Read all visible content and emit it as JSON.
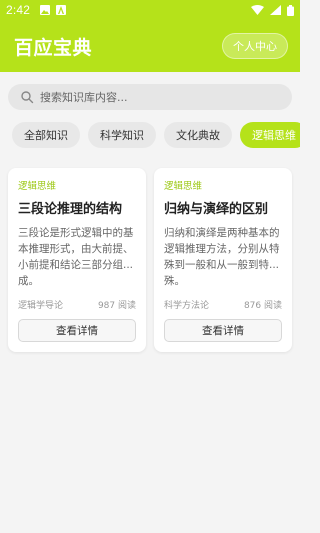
{
  "status_bar": {
    "time": "2:42",
    "icons": [
      "image-icon",
      "font-icon",
      "wifi-icon",
      "cellular-icon",
      "battery-icon"
    ]
  },
  "app": {
    "title": "百应宝典",
    "profile_button": "个人中心"
  },
  "search": {
    "placeholder": "搜索知识库内容..."
  },
  "categories": [
    {
      "label": "全部知识",
      "active": false
    },
    {
      "label": "科学知识",
      "active": false
    },
    {
      "label": "文化典故",
      "active": false
    },
    {
      "label": "逻辑思维",
      "active": true
    }
  ],
  "cards": [
    {
      "category": "逻辑思维",
      "title": "三段论推理的结构",
      "summary": "三段论是形式逻辑中的基本推理形式，由大前提、小前提和结论三部分组...成。",
      "source": "逻辑学导论",
      "reads": "987 阅读",
      "button": "查看详情"
    },
    {
      "category": "逻辑思维",
      "title": "归纳与演绎的区别",
      "summary": "归纳和演绎是两种基本的逻辑推理方法，分别从特殊到一般和从一般到特...殊。",
      "source": "科学方法论",
      "reads": "876 阅读",
      "button": "查看详情"
    }
  ],
  "colors": {
    "accent": "#b5e21a",
    "category_text": "#9cc814"
  }
}
